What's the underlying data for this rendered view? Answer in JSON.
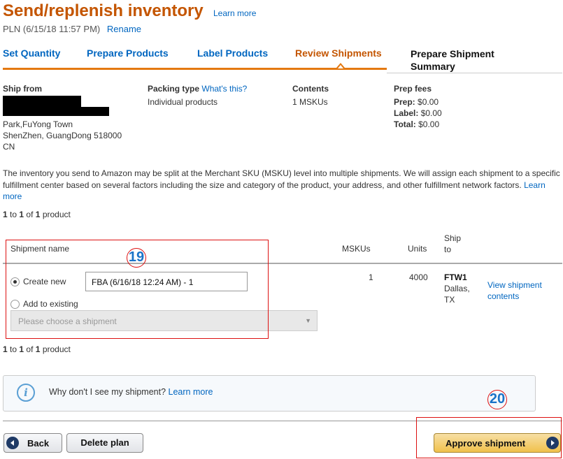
{
  "header": {
    "title": "Send/replenish inventory",
    "learn_more": "Learn more",
    "plan_name": "PLN (6/15/18 11:57 PM)",
    "rename": "Rename"
  },
  "tabs": [
    {
      "label": "Set Quantity",
      "state": "link"
    },
    {
      "label": "Prepare Products",
      "state": "link"
    },
    {
      "label": "Label Products",
      "state": "link"
    },
    {
      "label": "Review Shipments",
      "state": "active"
    },
    {
      "label_line1": "Prepare Shipment",
      "label_line2": "Summary",
      "state": "upcoming"
    }
  ],
  "info": {
    "ship_from_label": "Ship from",
    "ship_from_lines": [
      "Park,FuYong Town",
      "ShenZhen, GuangDong 518000",
      "CN"
    ],
    "packing_type_label": "Packing type",
    "whats_this": "What's this?",
    "packing_type_value": "Individual products",
    "contents_label": "Contents",
    "contents_value": "1 MSKUs",
    "prep_fees_label": "Prep fees",
    "prep_label": "Prep:",
    "prep_value": "$0.00",
    "label_label": "Label:",
    "label_value": "$0.00",
    "total_label": "Total:",
    "total_value": "$0.00"
  },
  "notice": {
    "text": "The inventory you send to Amazon may be split at the Merchant SKU (MSKU) level into multiple shipments. We will assign each shipment to a specific fulfillment center based on several factors including the size and category of the product, your address, and other fulfillment network factors.",
    "learn_more": "Learn more"
  },
  "pagination": {
    "from": "1",
    "to_word": "to",
    "to": "1",
    "of_word": "of",
    "total": "1",
    "unit": "product"
  },
  "table": {
    "headers": {
      "shipment_name": "Shipment name",
      "mskus": "MSKUs",
      "units": "Units",
      "ship_to_line1": "Ship",
      "ship_to_line2": "to"
    },
    "row": {
      "create_new_label": "Create new",
      "shipment_name_value": "FBA (6/16/18 12:24 AM) - 1",
      "add_existing_label": "Add to existing",
      "choose_placeholder": "Please choose a shipment",
      "mskus": "1",
      "units": "4000",
      "fc_code": "FTW1",
      "fc_city": "Dallas,",
      "fc_state": "TX",
      "view_contents_line1": "View shipment",
      "view_contents_line2": "contents"
    }
  },
  "help": {
    "question": "Why don't I see my shipment?",
    "learn_more": "Learn more"
  },
  "buttons": {
    "back": "Back",
    "delete_plan": "Delete plan",
    "approve": "Approve shipment"
  },
  "annotations": {
    "a19": "19",
    "a20": "20"
  },
  "colors": {
    "accent_orange": "#c45500",
    "link_blue": "#0066c0",
    "annotation_red": "#dd1111"
  }
}
